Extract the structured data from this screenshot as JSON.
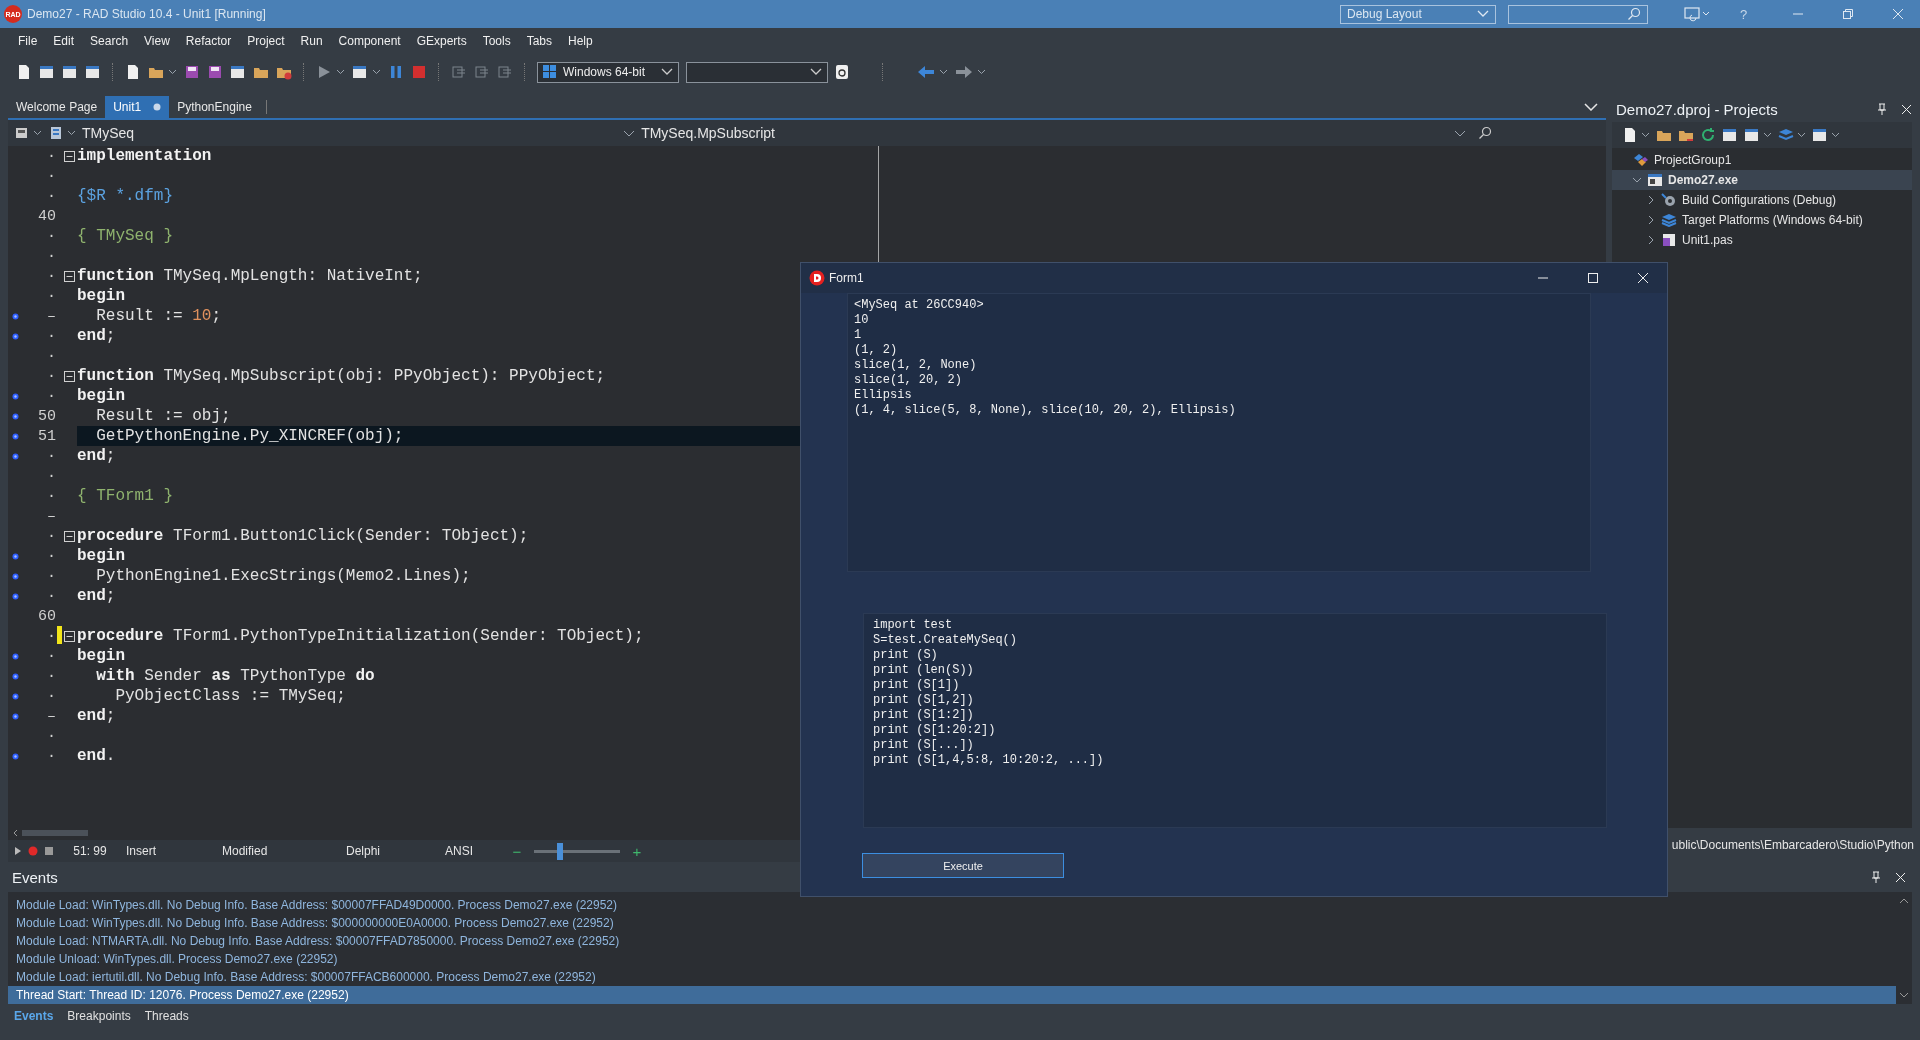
{
  "title_bar": {
    "logo": "RAD",
    "title": "Demo27 - RAD Studio 10.4 - Unit1 [Running]",
    "layout": "Debug Layout",
    "help": "?"
  },
  "menu": [
    "File",
    "Edit",
    "Search",
    "View",
    "Refactor",
    "Project",
    "Run",
    "Component",
    "GExperts",
    "Tools",
    "Tabs",
    "Help"
  ],
  "toolbar": {
    "platform": "Windows 64-bit"
  },
  "editor": {
    "tabs": [
      {
        "label": "Welcome Page",
        "selected": false,
        "modified": false
      },
      {
        "label": "Unit1",
        "selected": true,
        "modified": true
      },
      {
        "label": "PythonEngine",
        "selected": false,
        "modified": false
      }
    ],
    "unit_scope": "TMySeq",
    "method_scope": "TMySeq.MpSubscript",
    "lines": [
      {
        "gutter": "·",
        "executable": false,
        "fold": true,
        "modified": false,
        "highlighted": false,
        "segments": [
          {
            "kind": "kw",
            "text": "implementation"
          }
        ]
      },
      {
        "gutter": "·",
        "executable": false,
        "fold": false,
        "modified": false,
        "highlighted": false
      },
      {
        "gutter": "·",
        "executable": false,
        "fold": false,
        "modified": false,
        "highlighted": false,
        "segments": [
          {
            "kind": "directive",
            "text": "{$R *.dfm}"
          }
        ]
      },
      {
        "gutter": "40",
        "executable": false,
        "fold": false,
        "modified": false,
        "highlighted": false
      },
      {
        "gutter": "·",
        "executable": false,
        "fold": false,
        "modified": false,
        "highlighted": false,
        "segments": [
          {
            "kind": "comment",
            "text": "{ TMySeq }"
          }
        ]
      },
      {
        "gutter": "·",
        "executable": false,
        "fold": false,
        "modified": false,
        "highlighted": false
      },
      {
        "gutter": "·",
        "executable": false,
        "fold": true,
        "modified": false,
        "highlighted": false,
        "segments": [
          {
            "kind": "kw",
            "text": "function"
          },
          {
            "kind": "plain",
            "text": " TMySeq.MpLength: NativeInt;"
          }
        ]
      },
      {
        "gutter": "·",
        "executable": false,
        "fold": false,
        "modified": false,
        "highlighted": false,
        "segments": [
          {
            "kind": "kw",
            "text": "begin"
          }
        ]
      },
      {
        "gutter": "–",
        "executable": true,
        "fold": false,
        "modified": false,
        "highlighted": false,
        "segments": [
          {
            "kind": "plain",
            "text": "  Result := "
          },
          {
            "kind": "num",
            "text": "10"
          },
          {
            "kind": "plain",
            "text": ";"
          }
        ]
      },
      {
        "gutter": "·",
        "executable": true,
        "fold": false,
        "modified": false,
        "highlighted": false,
        "segments": [
          {
            "kind": "kw",
            "text": "end"
          },
          {
            "kind": "plain",
            "text": ";"
          }
        ]
      },
      {
        "gutter": "·",
        "executable": false,
        "fold": false,
        "modified": false,
        "highlighted": false
      },
      {
        "gutter": "·",
        "executable": false,
        "fold": true,
        "modified": false,
        "highlighted": false,
        "segments": [
          {
            "kind": "kw",
            "text": "function"
          },
          {
            "kind": "plain",
            "text": " TMySeq.MpSubscript(obj: PPyObject): PPyObject;"
          }
        ]
      },
      {
        "gutter": "·",
        "executable": true,
        "fold": false,
        "modified": false,
        "highlighted": false,
        "segments": [
          {
            "kind": "kw",
            "text": "begin"
          }
        ]
      },
      {
        "gutter": "50",
        "executable": true,
        "fold": false,
        "modified": false,
        "highlighted": false,
        "segments": [
          {
            "kind": "plain",
            "text": "  Result := obj;"
          }
        ]
      },
      {
        "gutter": "51",
        "executable": true,
        "fold": false,
        "modified": false,
        "highlighted": true,
        "segments": [
          {
            "kind": "plain",
            "text": "  GetPythonEngine.Py_XINCREF(obj);"
          }
        ]
      },
      {
        "gutter": "·",
        "executable": true,
        "fold": false,
        "modified": false,
        "highlighted": false,
        "segments": [
          {
            "kind": "kw",
            "text": "end"
          },
          {
            "kind": "plain",
            "text": ";"
          }
        ]
      },
      {
        "gutter": "·",
        "executable": false,
        "fold": false,
        "modified": false,
        "highlighted": false
      },
      {
        "gutter": "·",
        "executable": false,
        "fold": false,
        "modified": false,
        "highlighted": false,
        "segments": [
          {
            "kind": "comment",
            "text": "{ TForm1 }"
          }
        ]
      },
      {
        "gutter": "–",
        "executable": false,
        "fold": false,
        "modified": false,
        "highlighted": false
      },
      {
        "gutter": "·",
        "executable": false,
        "fold": true,
        "modified": false,
        "highlighted": false,
        "segments": [
          {
            "kind": "kw",
            "text": "procedure"
          },
          {
            "kind": "plain",
            "text": " TForm1.Button1Click(Sender: TObject);"
          }
        ]
      },
      {
        "gutter": "·",
        "executable": true,
        "fold": false,
        "modified": false,
        "highlighted": false,
        "segments": [
          {
            "kind": "kw",
            "text": "begin"
          }
        ]
      },
      {
        "gutter": "·",
        "executable": true,
        "fold": false,
        "modified": false,
        "highlighted": false,
        "segments": [
          {
            "kind": "plain",
            "text": "  PythonEngine1.ExecStrings(Memo2.Lines);"
          }
        ]
      },
      {
        "gutter": "·",
        "executable": true,
        "fold": false,
        "modified": false,
        "highlighted": false,
        "segments": [
          {
            "kind": "kw",
            "text": "end"
          },
          {
            "kind": "plain",
            "text": ";"
          }
        ]
      },
      {
        "gutter": "60",
        "executable": false,
        "fold": false,
        "modified": false,
        "highlighted": false
      },
      {
        "gutter": "·",
        "executable": false,
        "fold": true,
        "modified": true,
        "highlighted": false,
        "segments": [
          {
            "kind": "kw",
            "text": "procedure"
          },
          {
            "kind": "plain",
            "text": " TForm1.PythonTypeInitialization(Sender: TObject);"
          }
        ]
      },
      {
        "gutter": "·",
        "executable": true,
        "fold": false,
        "modified": false,
        "highlighted": false,
        "segments": [
          {
            "kind": "kw",
            "text": "begin"
          }
        ]
      },
      {
        "gutter": "·",
        "executable": true,
        "fold": false,
        "modified": false,
        "highlighted": false,
        "segments": [
          {
            "kind": "kw",
            "text": "  with"
          },
          {
            "kind": "plain",
            "text": " Sender "
          },
          {
            "kind": "kw",
            "text": "as"
          },
          {
            "kind": "plain",
            "text": " TPythonType "
          },
          {
            "kind": "kw",
            "text": "do"
          }
        ]
      },
      {
        "gutter": "·",
        "executable": true,
        "fold": false,
        "modified": false,
        "highlighted": false,
        "segments": [
          {
            "kind": "plain",
            "text": "    PyObjectClass := TMySeq;"
          }
        ]
      },
      {
        "gutter": "–",
        "executable": true,
        "fold": false,
        "modified": false,
        "highlighted": false,
        "segments": [
          {
            "kind": "kw",
            "text": "end"
          },
          {
            "kind": "plain",
            "text": ";"
          }
        ]
      },
      {
        "gutter": "·",
        "executable": false,
        "fold": false,
        "modified": false,
        "highlighted": false
      },
      {
        "gutter": "·",
        "executable": true,
        "fold": false,
        "modified": false,
        "highlighted": false,
        "segments": [
          {
            "kind": "kw",
            "text": "end"
          },
          {
            "kind": "plain",
            "text": "."
          }
        ]
      }
    ],
    "status": {
      "position": "51: 99",
      "mode": "Insert",
      "state": "Modified",
      "language": "Delphi",
      "encoding": "ANSI",
      "zoom_out": "−",
      "zoom_in": "+",
      "zoom": {
        "level": 0.3
      }
    }
  },
  "projects": {
    "title": "Demo27.dproj - Projects",
    "tree": [
      {
        "label": "ProjectGroup1",
        "kind": "group",
        "selected": false,
        "children": [
          {
            "label": "Demo27.exe",
            "kind": "exe",
            "expanded": true,
            "selected": true,
            "children": [
              {
                "label": "Build Configurations (Debug)",
                "kind": "config",
                "expanded": false,
                "selected": false
              },
              {
                "label": "Target Platforms (Windows 64-bit)",
                "kind": "platforms",
                "expanded": false,
                "selected": false
              },
              {
                "label": "Unit1.pas",
                "kind": "unit",
                "expanded": false,
                "selected": false
              }
            ]
          }
        ]
      }
    ],
    "path": "ublic\\Documents\\Embarcadero\\Studio\\Python"
  },
  "form": {
    "title": "Form1",
    "output": [
      "<MySeq at 26CC940>",
      "10",
      "1",
      "(1, 2)",
      "slice(1, 2, None)",
      "slice(1, 20, 2)",
      "Ellipsis",
      "(1, 4, slice(5, 8, None), slice(10, 20, 2), Ellipsis)"
    ],
    "script": [
      "import test",
      "S=test.CreateMySeq()",
      "print (S)",
      "print (len(S))",
      "print (S[1])",
      "print (S[1,2])",
      "print (S[1:2])",
      "print (S[1:20:2])",
      "print (S[...])",
      "print (S[1,4,5:8, 10:20:2, ...])"
    ],
    "button": "Execute"
  },
  "events": {
    "title": "Events",
    "lines": [
      {
        "text": "Module Load: WinTypes.dll. No Debug Info. Base Address: $00007FFAD49D0000. Process Demo27.exe (22952)",
        "selected": false
      },
      {
        "text": "Module Load: WinTypes.dll. No Debug Info. Base Address: $000000000E0A0000. Process Demo27.exe (22952)",
        "selected": false
      },
      {
        "text": "Module Load: NTMARTA.dll. No Debug Info. Base Address: $00007FFAD7850000. Process Demo27.exe (22952)",
        "selected": false
      },
      {
        "text": "Module Unload: WinTypes.dll. Process Demo27.exe (22952)",
        "selected": false
      },
      {
        "text": "Module Load: iertutil.dll. No Debug Info. Base Address: $00007FFACB600000. Process Demo27.exe (22952)",
        "selected": false
      },
      {
        "text": "Thread Start: Thread ID: 12076. Process Demo27.exe (22952)",
        "selected": true
      }
    ],
    "tabs": [
      {
        "label": "Events",
        "selected": true
      },
      {
        "label": "Breakpoints",
        "selected": false
      },
      {
        "label": "Threads",
        "selected": false
      }
    ]
  }
}
